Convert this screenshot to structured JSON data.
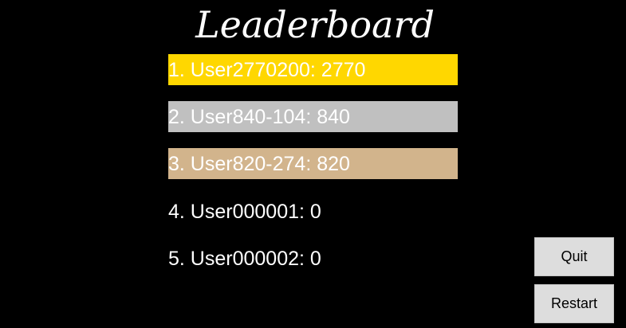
{
  "title": "Leaderboard",
  "entries": [
    {
      "text": "1. User2770200: 2770",
      "color": "#ffd700"
    },
    {
      "text": "2. User840-104: 840",
      "color": "#c0c0c0"
    },
    {
      "text": "3. User820-274: 820",
      "color": "#d2b48c"
    },
    {
      "text": "4. User000001: 0",
      "color": "#000000"
    },
    {
      "text": "5. User000002: 0",
      "color": "#000000"
    }
  ],
  "buttons": {
    "quit_label": "Quit",
    "restart_label": "Restart"
  },
  "colors": {
    "background": "#000000",
    "text": "#ffffff",
    "button": "#dddddd"
  }
}
